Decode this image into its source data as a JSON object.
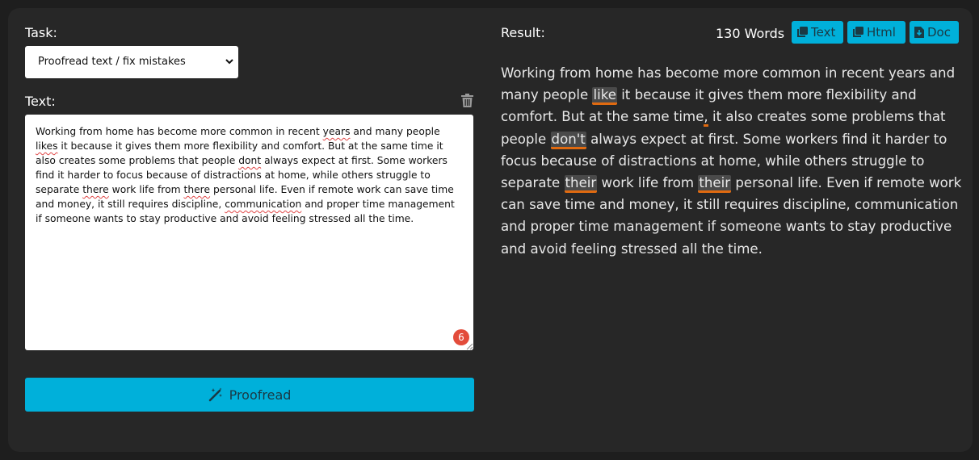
{
  "task": {
    "label": "Task:",
    "selected": "Proofread text / fix mistakes"
  },
  "text": {
    "label": "Text:",
    "segments": [
      {
        "t": "Working from home has become more common in recent ",
        "u": false
      },
      {
        "t": "years",
        "u": true
      },
      {
        "t": " and many people ",
        "u": false
      },
      {
        "t": "likes",
        "u": true
      },
      {
        "t": " it because it gives them more flexibility and comfort. But at the same time it also creates some problems that people ",
        "u": false
      },
      {
        "t": "dont",
        "u": true
      },
      {
        "t": " always expect at first. Some workers find it harder to focus because of distractions at home, while others struggle to separate ",
        "u": false
      },
      {
        "t": "there",
        "u": true
      },
      {
        "t": " work life from ",
        "u": false
      },
      {
        "t": "there",
        "u": true
      },
      {
        "t": " personal life. Even if remote work can save time and money, it still requires discipline, ",
        "u": false
      },
      {
        "t": "communication",
        "u": true
      },
      {
        "t": " and proper time management if someone wants to stay productive and avoid feeling stressed all the time.",
        "u": false
      }
    ],
    "error_count": "6"
  },
  "actions": {
    "proofread_label": "Proofread"
  },
  "result": {
    "label": "Result:",
    "word_count": "130 Words",
    "copy_text": "Text",
    "copy_html": "Html",
    "copy_doc": "Doc",
    "segments": [
      {
        "t": "Working from home has become more common in recent years and many people ",
        "h": ""
      },
      {
        "t": "like",
        "h": "word"
      },
      {
        "t": " it because it gives them more flexibility and comfort. But at the same time",
        "h": ""
      },
      {
        "t": ",",
        "h": "comma"
      },
      {
        "t": " it also creates some problems that people ",
        "h": ""
      },
      {
        "t": "don't",
        "h": "word"
      },
      {
        "t": " always expect at first. Some workers find it harder to focus because of distractions at home, while others struggle to separate ",
        "h": ""
      },
      {
        "t": "their",
        "h": "word"
      },
      {
        "t": " work life from ",
        "h": ""
      },
      {
        "t": "their",
        "h": "word"
      },
      {
        "t": " personal life. Even if remote work can save time and money, it still requires discipline, communication and proper time management if someone wants to stay productive and avoid feeling stressed all the time.",
        "h": ""
      }
    ]
  },
  "colors": {
    "accent": "#00b0da",
    "highlight_underline": "#e06a10",
    "error_badge": "#e34c3b",
    "panel": "#272727"
  },
  "icons": [
    "chevron-down-icon",
    "trash-icon",
    "magic-wand-icon",
    "copy-icon",
    "download-icon"
  ]
}
